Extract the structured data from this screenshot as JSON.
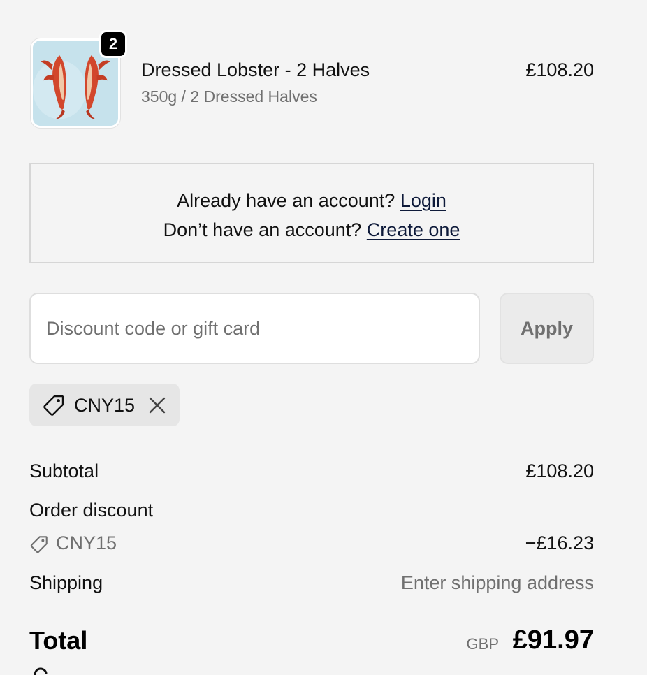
{
  "line_item": {
    "quantity": "2",
    "title": "Dressed Lobster - 2 Halves",
    "variant": "350g / 2 Dressed Halves",
    "price": "£108.20"
  },
  "account": {
    "login_prompt": "Already have an account?",
    "login_link": "Login",
    "create_prompt": "Don’t have an account?",
    "create_link": "Create one"
  },
  "discount": {
    "placeholder": "Discount code or gift card",
    "value": "",
    "apply_label": "Apply",
    "applied_code": "CNY15"
  },
  "summary": {
    "subtotal_label": "Subtotal",
    "subtotal_value": "£108.20",
    "order_discount_label": "Order discount",
    "discount_code": "CNY15",
    "discount_value": "−£16.23",
    "shipping_label": "Shipping",
    "shipping_value": "Enter shipping address",
    "total_label": "Total",
    "currency": "GBP",
    "total_value": "£91.97"
  },
  "icons": {
    "tag": "tag-icon",
    "remove": "close-icon"
  },
  "colors": {
    "background": "#f4f4f4",
    "muted_text": "#707070",
    "link": "#0e1a3a",
    "badge": "#000000"
  }
}
